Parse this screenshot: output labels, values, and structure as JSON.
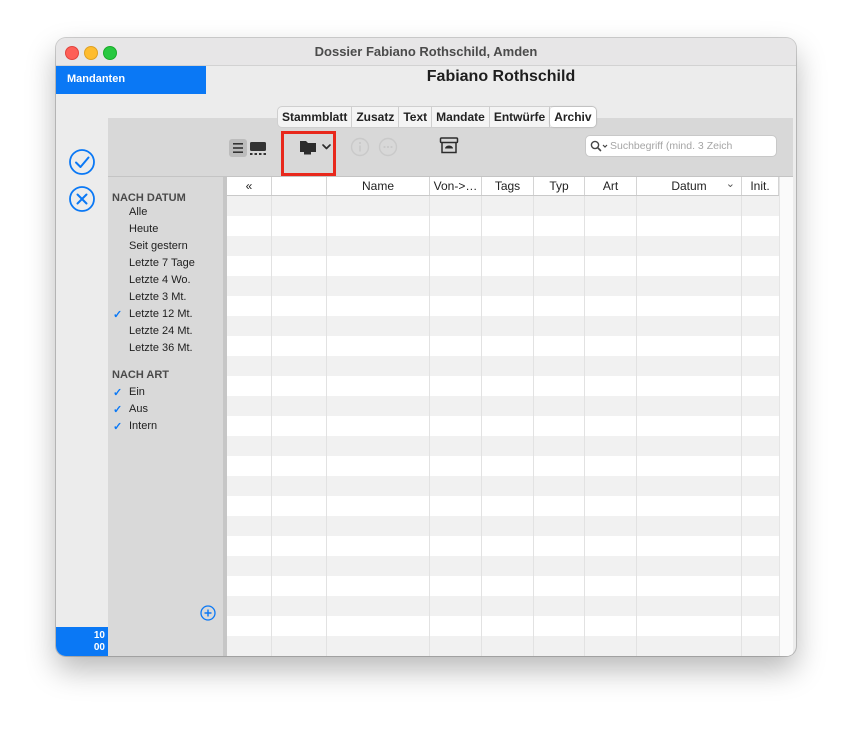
{
  "window": {
    "title": "Dossier Fabiano Rothschild, Amden"
  },
  "sidebar_nav": {
    "mandanten_label": "Mandanten"
  },
  "client": {
    "name": "Fabiano Rothschild"
  },
  "left_actions": {
    "counter": "10\n00"
  },
  "tabs": [
    {
      "label": "Stammblatt"
    },
    {
      "label": "Zusatz"
    },
    {
      "label": "Text"
    },
    {
      "label": "Mandate"
    },
    {
      "label": "Entwürfe"
    },
    {
      "label": "Archiv",
      "active": true
    }
  ],
  "toolbar": {
    "view_toggle_icons": [
      "list-view-icon",
      "grid-view-icon"
    ],
    "folder_menu_icon": "folder-dropdown-icon",
    "info_icon": "info-icon",
    "more_icon": "more-icon",
    "archive_icon": "archive-box-icon",
    "search_placeholder": "Suchbegriff (mind. 3 Zeich"
  },
  "filters": {
    "date_heading": "NACH DATUM",
    "date_items": [
      {
        "label": "Alle",
        "checked": false
      },
      {
        "label": "Heute",
        "checked": false
      },
      {
        "label": "Seit gestern",
        "checked": false
      },
      {
        "label": "Letzte 7 Tage",
        "checked": false
      },
      {
        "label": "Letzte 4 Wo.",
        "checked": false
      },
      {
        "label": "Letzte 3 Mt.",
        "checked": false
      },
      {
        "label": "Letzte 12 Mt.",
        "checked": true
      },
      {
        "label": "Letzte 24 Mt.",
        "checked": false
      },
      {
        "label": "Letzte 36 Mt.",
        "checked": false
      }
    ],
    "type_heading": "NACH ART",
    "type_items": [
      {
        "label": "Ein",
        "checked": true
      },
      {
        "label": "Aus",
        "checked": true
      },
      {
        "label": "Intern",
        "checked": true
      }
    ],
    "check_mark": "✓"
  },
  "table": {
    "columns": [
      "«",
      "",
      "Name",
      "Von->…",
      "Tags",
      "Typ",
      "Art",
      "Datum",
      "Init."
    ],
    "sort_indicator": "⌄"
  },
  "colors": {
    "accent": "#0a78f5",
    "highlight": "#e8281c"
  }
}
